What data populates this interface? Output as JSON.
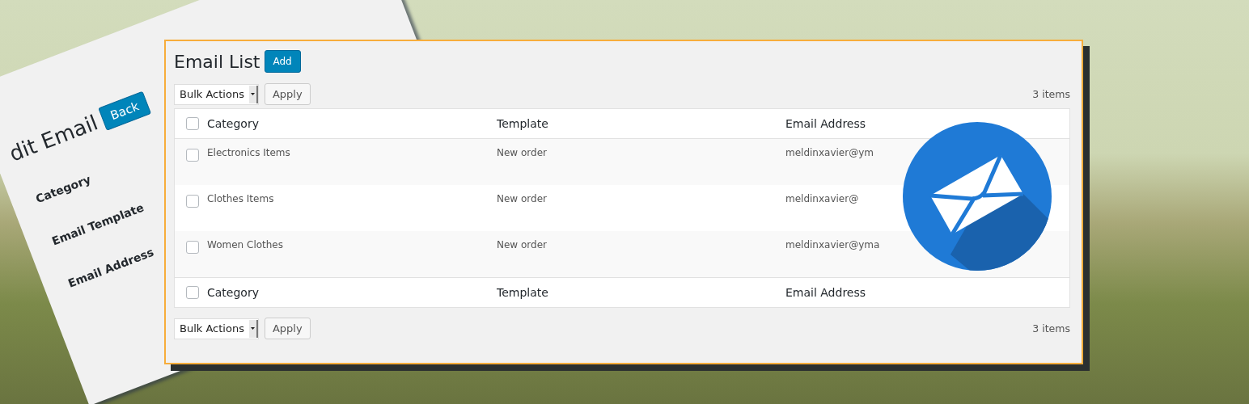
{
  "edit_card": {
    "title": "dit Email",
    "back_button": "Back",
    "fields": [
      "Category",
      "Email Template",
      "Email Address"
    ]
  },
  "panel": {
    "title": "Email List",
    "add_button": "Add",
    "top_nav": {
      "bulk_actions": "Bulk Actions",
      "apply": "Apply",
      "count": "3 items"
    },
    "table": {
      "select_all_top": {
        "checked": false
      },
      "select_all_bottom": {
        "checked": false
      },
      "columns": [
        "Category",
        "Template",
        "Email Address"
      ],
      "footer_columns": [
        "Category",
        "Template",
        "Email Address"
      ],
      "rows": [
        {
          "checked": false,
          "category": "Electronics Items",
          "template": "New order",
          "email": "meldinxavier@ym"
        },
        {
          "checked": false,
          "category": "Clothes Items",
          "template": "New order",
          "email": "meldinxavier@"
        },
        {
          "checked": false,
          "category": "Women Clothes",
          "template": "New order",
          "email": "meldinxavier@yma"
        }
      ]
    },
    "bottom_nav": {
      "bulk_actions": "Bulk Actions",
      "apply": "Apply",
      "count": "3 items"
    }
  }
}
